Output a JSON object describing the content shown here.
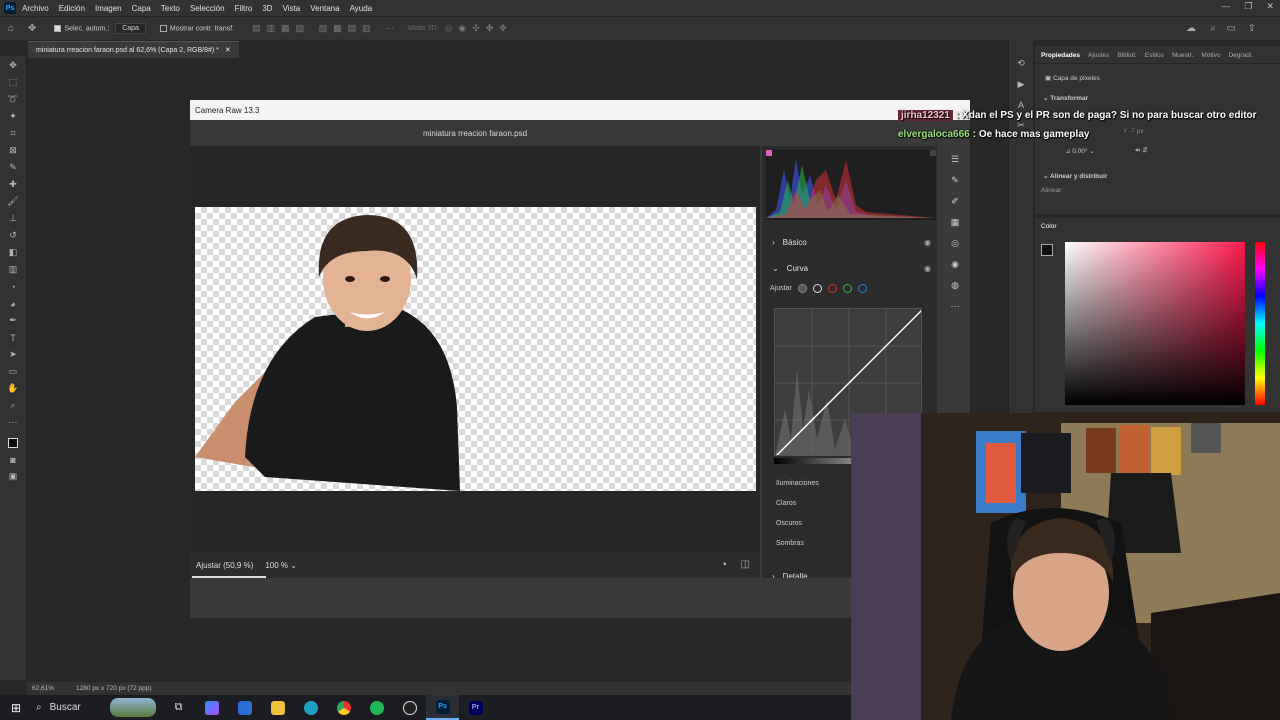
{
  "menubar": {
    "items": [
      "Archivo",
      "Edición",
      "Imagen",
      "Capa",
      "Texto",
      "Selección",
      "Filtro",
      "3D",
      "Vista",
      "Ventana",
      "Ayuda"
    ],
    "logo": "Ps"
  },
  "options": {
    "auto_select_label": "Selec. autom.:",
    "auto_select_value": "Capa",
    "transform_label": "Mostrar contr. transf.",
    "mode_3d_label": "Modo 3D:"
  },
  "document": {
    "tab_title": "miniatura rreacion faraon.psd al 62,6% (Capa 2, RGB/8#) *"
  },
  "camera_raw": {
    "title": "Camera Raw 13.3",
    "filename": "miniatura rreacion faraon.psd",
    "zoom_fit": "Ajustar (50,9 %)",
    "zoom_pct": "100 %",
    "sections": {
      "basico": "Básico",
      "curva": "Curva",
      "ajustar": "Ajustar",
      "detalle": "Detalle"
    },
    "sliders": [
      "Iluminaciones",
      "Claros",
      "Oscuros",
      "Sombras"
    ]
  },
  "right_panel": {
    "tabs": [
      "Propiedades",
      "Ajustes",
      "Bibliot.",
      "Estilos",
      "Muestr.",
      "Motivo",
      "Degradi."
    ],
    "pixel_layer": "Capa de píxeles",
    "transform": "Transformar",
    "angle": "0,00°",
    "y_field": "Y  -7 px",
    "align_section": "Alinear y distribuir",
    "align_label": "Alinear:",
    "color_title": "Color"
  },
  "chat": [
    {
      "user": "jirha12321",
      "message": ": Xdan el PS y el PR son de paga? Si no para buscar otro editor"
    },
    {
      "user": "elvergaloca666",
      "message": ": Oe hace mas gameplay"
    }
  ],
  "statusbar": {
    "zoom": "62,61%",
    "size": "1280 px x 720 px (72 ppp)"
  },
  "taskbar": {
    "search_label": "Buscar"
  },
  "colors": {
    "ps_blue": "#31a8ff",
    "chat_user1_bg": "#6b2736",
    "chat_user2": "#9be07b",
    "accent_pink": "#ff1a4e"
  }
}
